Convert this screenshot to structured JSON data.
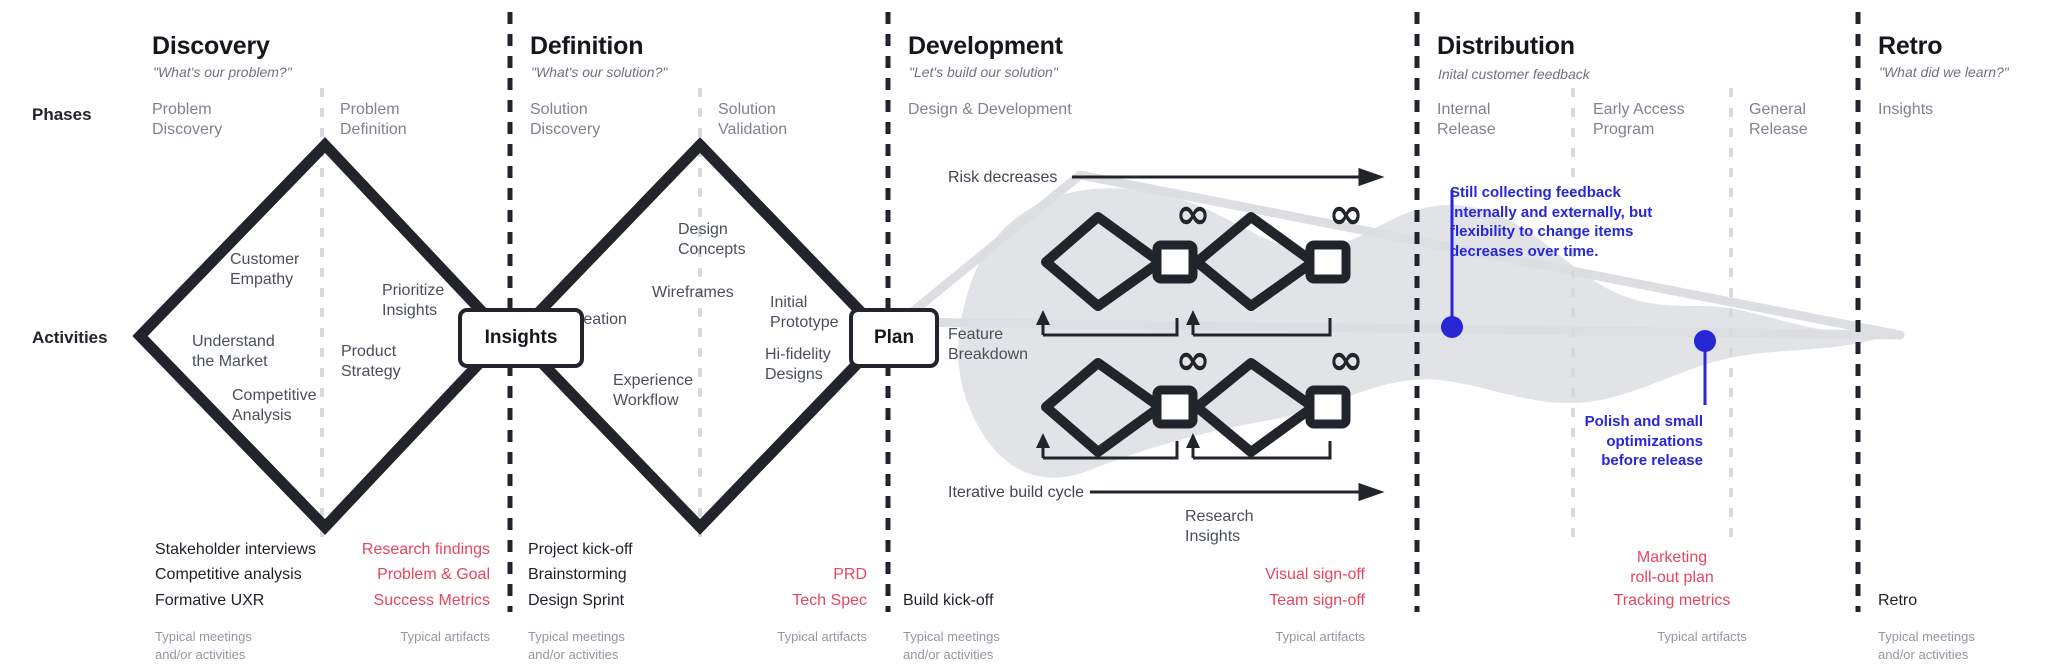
{
  "row_labels": {
    "phases": "Phases",
    "activities": "Activities"
  },
  "phases": [
    {
      "key": "discovery",
      "title": "Discovery",
      "subtitle": "\"What's our problem?\"",
      "subphases": [
        "Problem\nDiscovery",
        "Problem\nDefinition"
      ],
      "activities": [
        "Customer\nEmpathy",
        "Understand\nthe Market",
        "Competitive\nAnalysis",
        "Prioritize\nInsights",
        "Product\nStrategy"
      ],
      "bottom_left": [
        "Stakeholder interviews",
        "Competitive analysis",
        "Formative UXR"
      ],
      "bottom_right": [
        "Research findings",
        "Problem & Goal",
        "Success Metrics"
      ],
      "caption_left": "Typical meetings\nand/or activities",
      "caption_right": "Typical artifacts"
    },
    {
      "key": "definition",
      "title": "Definition",
      "subtitle": "\"What's our solution?\"",
      "subphases": [
        "Solution\nDiscovery",
        "Solution\nValidation"
      ],
      "activities": [
        "Ideation",
        "Design\nConcepts",
        "Wireframes",
        "Experience\nWorkflow",
        "Initial\nPrototype",
        "Hi-fidelity\nDesigns"
      ],
      "bottom_left": [
        "Project kick-off",
        "Brainstorming",
        "Design Sprint"
      ],
      "bottom_right": [
        "",
        "PRD",
        "Tech Spec"
      ],
      "caption_left": "Typical meetings\nand/or activities",
      "caption_right": "Typical artifacts"
    },
    {
      "key": "development",
      "title": "Development",
      "subtitle": "\"Let's build our solution\"",
      "subphases": [
        "Design & Development"
      ],
      "activities": [
        "Feature\nBreakdown",
        "Research\nInsights"
      ],
      "bottom_left": [
        "Build kick-off"
      ],
      "bottom_right": [
        "Visual sign-off",
        "Team sign-off"
      ],
      "caption_left": "Typical meetings\nand/or activities",
      "caption_right": "Typical artifacts"
    },
    {
      "key": "distribution",
      "title": "Distribution",
      "subtitle": "Inital customer feedback",
      "subphases": [
        "Internal\nRelease",
        "Early Access\nProgram",
        "General\nRelease"
      ],
      "activities": [],
      "bottom_left": [],
      "bottom_right": [
        "Marketing\nroll-out plan",
        "Tracking metrics"
      ],
      "caption_left": "",
      "caption_right": "Typical artifacts"
    },
    {
      "key": "retro",
      "title": "Retro",
      "subtitle": "\"What did we learn?\"",
      "subphases": [
        "Insights"
      ],
      "activities": [],
      "bottom_left": [
        "Retro"
      ],
      "bottom_right": [],
      "caption_left": "Typical meetings\nand/or activities",
      "caption_right": ""
    }
  ],
  "gates": [
    {
      "key": "insights",
      "label": "Insights"
    },
    {
      "key": "plan",
      "label": "Plan"
    }
  ],
  "flow_labels": {
    "risk": "Risk decreases",
    "iterative": "Iterative build cycle"
  },
  "annotations": [
    {
      "key": "feedback",
      "text": "Still collecting feedback\ninternally and externally, but\nflexibility to change items\ndecreases over time."
    },
    {
      "key": "polish",
      "text": "Polish and small\noptimizations\nbefore release"
    }
  ],
  "colors": {
    "ink": "#22242c",
    "muted": "#7e838d",
    "red": "#e8455f",
    "blue": "#2727d6",
    "blob": "#e2e3e6",
    "divider": "#d7d9dd"
  },
  "icons": {
    "infinity": "∞"
  },
  "dev_cells": [
    {
      "key": "cell-1"
    },
    {
      "key": "cell-2"
    },
    {
      "key": "cell-3"
    },
    {
      "key": "cell-4"
    }
  ]
}
